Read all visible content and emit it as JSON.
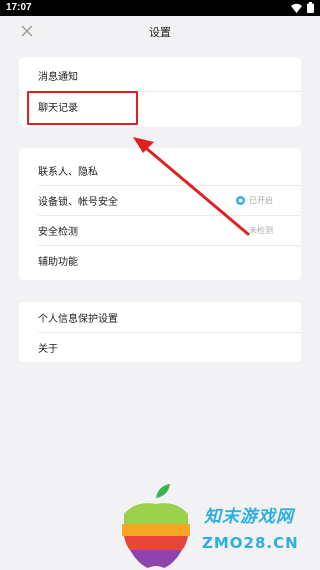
{
  "status_bar": {
    "time": "17:07",
    "wifi_icon": "wifi-icon",
    "battery_icon": "battery-icon"
  },
  "header": {
    "title": "设置",
    "close_icon": "close-icon"
  },
  "groups": [
    {
      "items": [
        {
          "label": "消息通知"
        },
        {
          "label": "聊天记录"
        }
      ]
    },
    {
      "items": [
        {
          "label": "联系人、隐私"
        },
        {
          "label": "设备锁、帐号安全",
          "status": "已开启",
          "status_color": "#2bb0e0"
        },
        {
          "label": "安全检测",
          "status": "未检测"
        },
        {
          "label": "辅助功能"
        }
      ]
    },
    {
      "items": [
        {
          "label": "个人信息保护设置"
        },
        {
          "label": "关于"
        }
      ]
    }
  ],
  "annotation": {
    "color": "#e02020",
    "target": "聊天记录"
  },
  "watermark": {
    "brand": "知末游戏网",
    "domain": "ZMO28.CN",
    "color": "#2bb0e0"
  }
}
